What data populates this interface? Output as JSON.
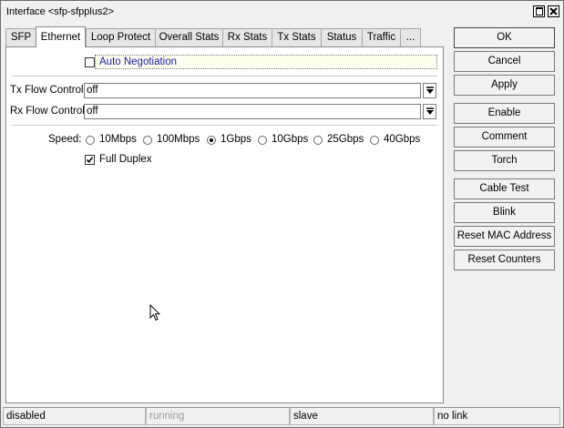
{
  "window": {
    "title": "Interface <sfp-sfpplus2>"
  },
  "tabs": [
    {
      "label": "SFP"
    },
    {
      "label": "Ethernet"
    },
    {
      "label": "Loop Protect"
    },
    {
      "label": "Overall Stats"
    },
    {
      "label": "Rx Stats"
    },
    {
      "label": "Tx Stats"
    },
    {
      "label": "Status"
    },
    {
      "label": "Traffic"
    },
    {
      "label": "..."
    }
  ],
  "ethernet": {
    "auto_negotiation": {
      "label": "Auto Negotiation",
      "checked": false
    },
    "tx_flow_control": {
      "label": "Tx Flow Control:",
      "value": "off"
    },
    "rx_flow_control": {
      "label": "Rx Flow Control:",
      "value": "off"
    },
    "speed": {
      "label": "Speed:",
      "options": [
        "10Mbps",
        "100Mbps",
        "1Gbps",
        "10Gbps",
        "25Gbps",
        "40Gbps"
      ],
      "selected": "1Gbps"
    },
    "full_duplex": {
      "label": "Full Duplex",
      "checked": true
    }
  },
  "buttons": {
    "ok": "OK",
    "cancel": "Cancel",
    "apply": "Apply",
    "enable": "Enable",
    "comment": "Comment",
    "torch": "Torch",
    "cable_test": "Cable Test",
    "blink": "Blink",
    "reset_mac": "Reset MAC Address",
    "reset_counters": "Reset Counters"
  },
  "status": [
    "disabled",
    "running",
    "slave",
    "no link"
  ],
  "colors": {
    "link_blue": "#1a1aa6",
    "autoneg_bg": "#fffff0"
  }
}
